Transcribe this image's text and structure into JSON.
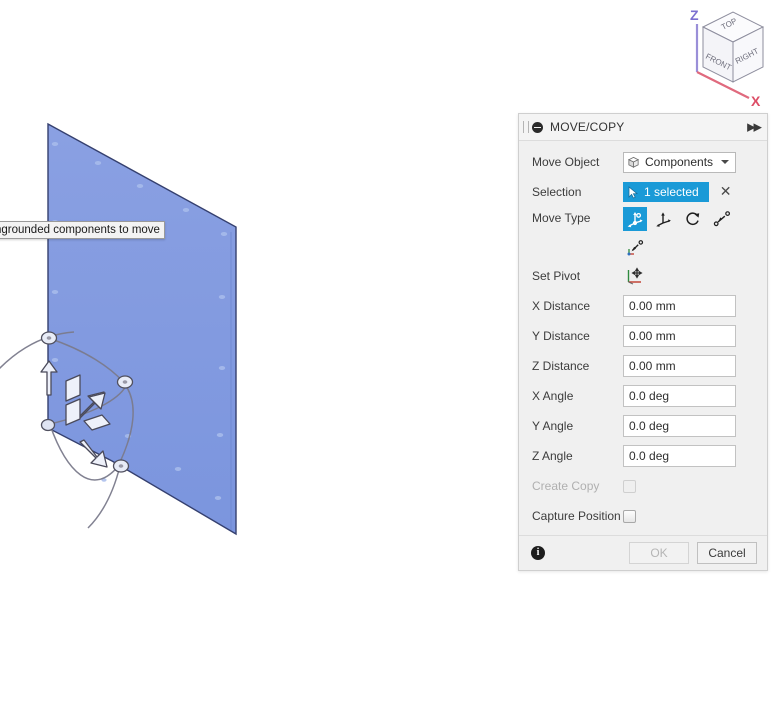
{
  "tooltip": {
    "text": "ngrounded components to move"
  },
  "viewcube": {
    "face_top": "TOP",
    "face_front": "FRONT",
    "face_right": "RIGHT",
    "axis_z": "Z",
    "axis_x": "X",
    "axis_z_color": "#9a8fd8",
    "axis_x_color": "#e06a7e"
  },
  "model": {
    "body_fill": "#7d96de",
    "body_stroke": "#3b4a7a",
    "gizmo_fill": "#e8ecf7",
    "gizmo_stroke": "#4a4a5a"
  },
  "dialog": {
    "title": "MOVE/COPY",
    "collapse_icon": "collapse-circle-icon",
    "expand_icon": "expand-chevrons-icon",
    "accent_color": "#1a9ad7",
    "rows": {
      "move_object": {
        "label": "Move Object",
        "value": "Components",
        "icon": "components-cube-icon"
      },
      "selection": {
        "label": "Selection",
        "value": "1 selected",
        "clear_label": "✕",
        "cursor_icon": "selection-cursor-icon"
      },
      "move_type": {
        "label": "Move Type",
        "buttons": [
          {
            "name": "free-move-icon",
            "active": true
          },
          {
            "name": "translate-icon",
            "active": false
          },
          {
            "name": "rotate-icon",
            "active": false
          },
          {
            "name": "point-to-point-icon",
            "active": false
          }
        ],
        "second_row": [
          {
            "name": "point-to-position-icon",
            "active": false
          }
        ]
      },
      "set_pivot": {
        "label": "Set Pivot",
        "icon": "set-pivot-axes-icon"
      },
      "x_distance": {
        "label": "X Distance",
        "value": "0.00 mm"
      },
      "y_distance": {
        "label": "Y Distance",
        "value": "0.00 mm"
      },
      "z_distance": {
        "label": "Z Distance",
        "value": "0.00 mm"
      },
      "x_angle": {
        "label": "X Angle",
        "value": "0.0 deg"
      },
      "y_angle": {
        "label": "Y Angle",
        "value": "0.0 deg"
      },
      "z_angle": {
        "label": "Z Angle",
        "value": "0.0 deg"
      },
      "create_copy": {
        "label": "Create Copy",
        "checked": false,
        "disabled": true
      },
      "capture_position": {
        "label": "Capture Position",
        "checked": false,
        "disabled": false
      }
    },
    "footer": {
      "info_label": "i",
      "ok_label": "OK",
      "cancel_label": "Cancel",
      "ok_disabled": true
    }
  }
}
